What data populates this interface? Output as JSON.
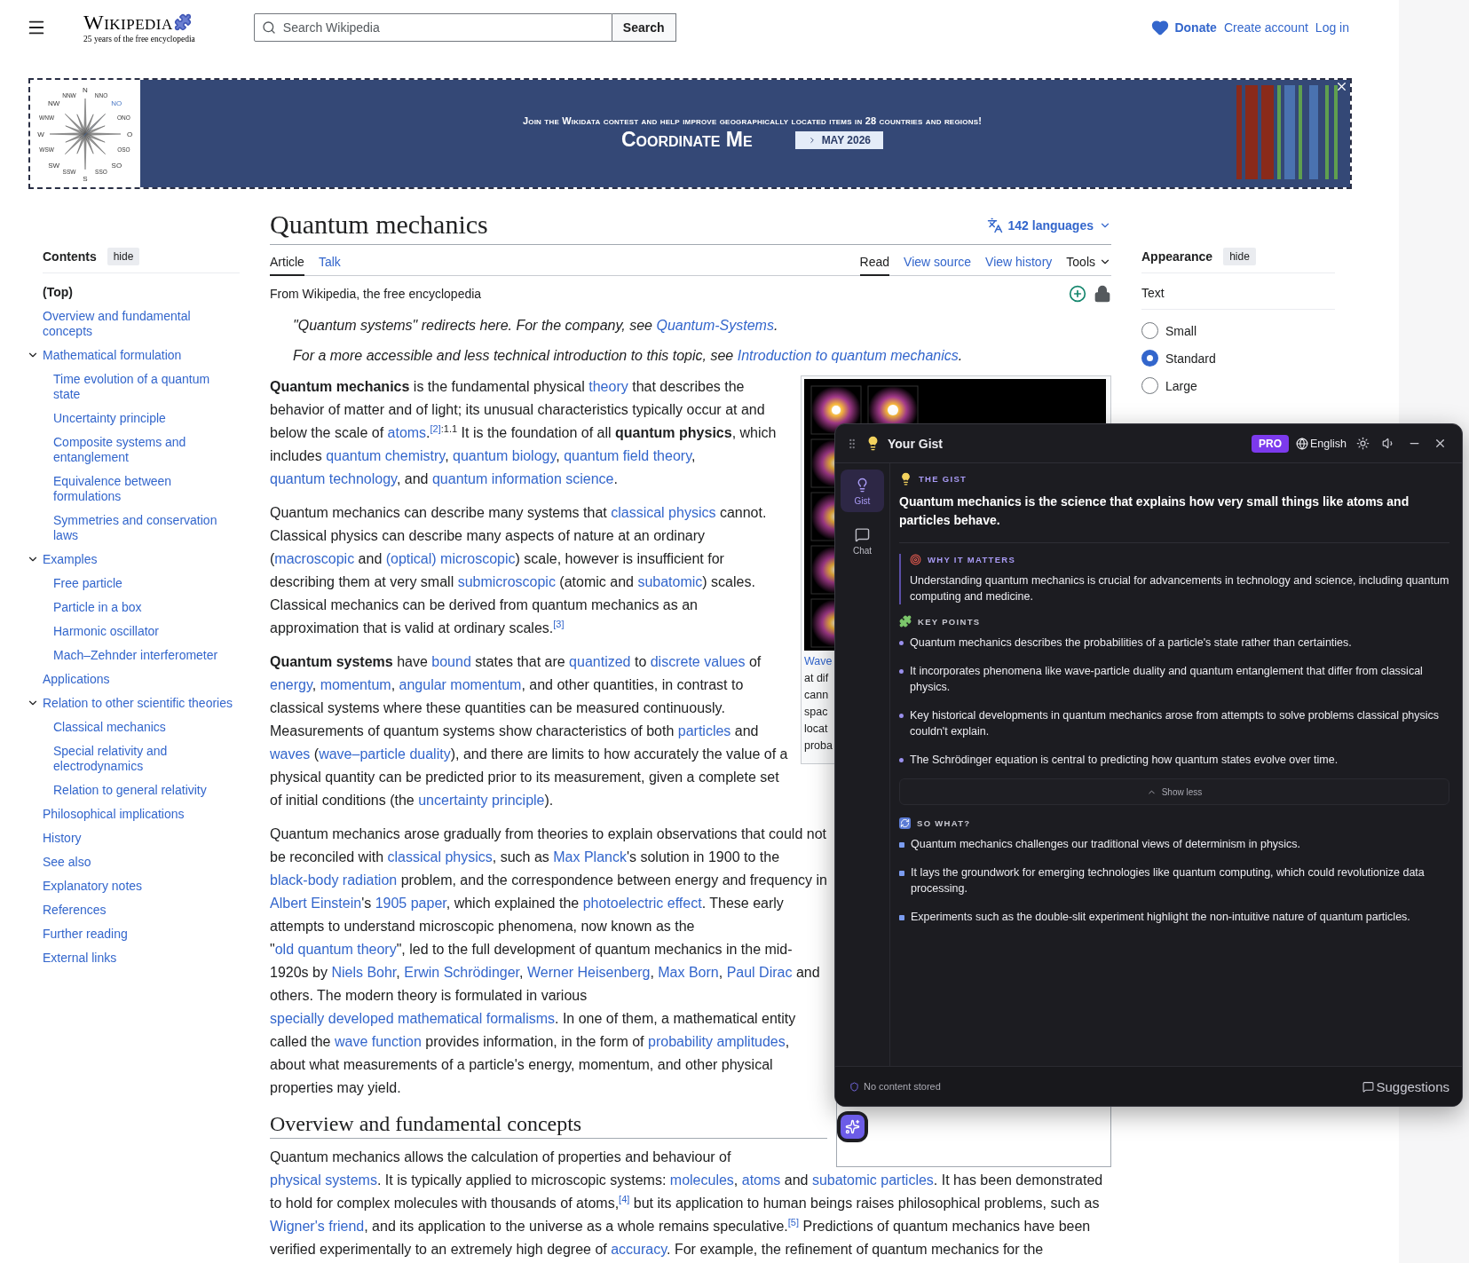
{
  "header": {
    "wordmark": "Wikipedia",
    "tagline": "25 years of the free encyclopedia",
    "search": {
      "placeholder": "Search Wikipedia",
      "button": "Search"
    },
    "links": [
      {
        "label": "Donate",
        "kind": "donate"
      },
      {
        "label": "Create account",
        "kind": "plain"
      },
      {
        "label": "Log in",
        "kind": "plain"
      }
    ]
  },
  "banner": {
    "compass_labels": [
      "N",
      "NNW",
      "NNO",
      "NW",
      "NO",
      "WNW",
      "ONO",
      "W",
      "O",
      "WSW",
      "OSO",
      "SW",
      "SO",
      "SSW",
      "SSO",
      "S"
    ],
    "headline": "Join the Wikidata contest and help improve geographically located items in 28 countries and regions!",
    "title": "Coordinate Me",
    "date": "MAY 2026"
  },
  "toc": {
    "title": "Contents",
    "hide": "hide",
    "items": [
      {
        "label": "(Top)",
        "selected": true
      },
      {
        "label": "Overview and fundamental concepts",
        "selected": false
      },
      {
        "label": "Mathematical formulation",
        "selected": false,
        "expanded": true,
        "children": [
          {
            "label": "Time evolution of a quantum state",
            "selected": false
          },
          {
            "label": "Uncertainty principle",
            "selected": false
          },
          {
            "label": "Composite systems and entanglement",
            "selected": false
          },
          {
            "label": "Equivalence between formulations",
            "selected": false
          },
          {
            "label": "Symmetries and conservation laws",
            "selected": false
          }
        ]
      },
      {
        "label": "Examples",
        "selected": false,
        "expanded": true,
        "children": [
          {
            "label": "Free particle",
            "selected": false
          },
          {
            "label": "Particle in a box",
            "selected": false
          },
          {
            "label": "Harmonic oscillator",
            "selected": false
          },
          {
            "label": "Mach–Zehnder interferometer",
            "selected": false
          }
        ]
      },
      {
        "label": "Applications",
        "selected": false
      },
      {
        "label": "Relation to other scientific theories",
        "selected": false,
        "expanded": true,
        "children": [
          {
            "label": "Classical mechanics",
            "selected": false
          },
          {
            "label": "Special relativity and electrodynamics",
            "selected": false
          },
          {
            "label": "Relation to general relativity",
            "selected": false
          }
        ]
      },
      {
        "label": "Philosophical implications",
        "selected": false
      },
      {
        "label": "History",
        "selected": false
      },
      {
        "label": "See also",
        "selected": false
      },
      {
        "label": "Explanatory notes",
        "selected": false
      },
      {
        "label": "References",
        "selected": false
      },
      {
        "label": "Further reading",
        "selected": false
      },
      {
        "label": "External links",
        "selected": false
      }
    ]
  },
  "article": {
    "title": "Quantum mechanics",
    "languages": "142 languages",
    "tabs_left": [
      {
        "label": "Article",
        "selected": true
      },
      {
        "label": "Talk",
        "selected": false
      }
    ],
    "tabs_right": [
      {
        "label": "Read",
        "selected": true
      },
      {
        "label": "View source",
        "selected": false
      },
      {
        "label": "View history",
        "selected": false
      }
    ],
    "tools": "Tools",
    "tagline": "From Wikipedia, the free encyclopedia",
    "infobox": {
      "caption_lines": [
        {
          "kind": "link",
          "text": "Wave"
        },
        {
          "kind": "text",
          "text": "at dif"
        },
        {
          "kind": "text",
          "text": "cann"
        },
        {
          "kind": "text",
          "text": "spac"
        },
        {
          "kind": "text",
          "text": "locat"
        },
        {
          "kind": "text",
          "text": "proba"
        }
      ]
    },
    "blocks": [
      {
        "kind": "hatnote",
        "runs": [
          {
            "kind": "text",
            "text": "\"Quantum systems\" redirects here. For the company, see "
          },
          {
            "kind": "link",
            "text": "Quantum-Systems"
          },
          {
            "kind": "text",
            "text": "."
          }
        ]
      },
      {
        "kind": "hatnote",
        "runs": [
          {
            "kind": "text",
            "text": "For a more accessible and less technical introduction to this topic, see "
          },
          {
            "kind": "link",
            "text": "Introduction to quantum mechanics"
          },
          {
            "kind": "text",
            "text": "."
          }
        ]
      },
      {
        "kind": "paragraph",
        "runs": [
          {
            "kind": "bold",
            "text": "Quantum mechanics"
          },
          {
            "kind": "text",
            "text": " is the fundamental physical "
          },
          {
            "kind": "link",
            "text": "theory"
          },
          {
            "kind": "text",
            "text": " that describes the behavior of matter and of light; its unusual characteristics typically occur at and below the scale of "
          },
          {
            "kind": "link",
            "text": "atoms"
          },
          {
            "kind": "text",
            "text": "."
          },
          {
            "kind": "ref",
            "text": "[2]"
          },
          {
            "kind": "sup",
            "text": ":1.1"
          },
          {
            "kind": "text",
            "text": " It is the foundation of all "
          },
          {
            "kind": "bold",
            "text": "quantum physics"
          },
          {
            "kind": "text",
            "text": ", which includes "
          },
          {
            "kind": "link",
            "text": "quantum chemistry"
          },
          {
            "kind": "text",
            "text": ", "
          },
          {
            "kind": "link",
            "text": "quantum biology"
          },
          {
            "kind": "text",
            "text": ", "
          },
          {
            "kind": "link",
            "text": "quantum field theory"
          },
          {
            "kind": "text",
            "text": ", "
          },
          {
            "kind": "link",
            "text": "quantum technology"
          },
          {
            "kind": "text",
            "text": ", and "
          },
          {
            "kind": "link",
            "text": "quantum information science"
          },
          {
            "kind": "text",
            "text": "."
          }
        ]
      },
      {
        "kind": "paragraph",
        "runs": [
          {
            "kind": "text",
            "text": "Quantum mechanics can describe many systems that "
          },
          {
            "kind": "link",
            "text": "classical physics"
          },
          {
            "kind": "text",
            "text": " cannot. Classical physics can describe many aspects of nature at an ordinary ("
          },
          {
            "kind": "link",
            "text": "macroscopic"
          },
          {
            "kind": "text",
            "text": " and "
          },
          {
            "kind": "link",
            "text": "(optical) microscopic"
          },
          {
            "kind": "text",
            "text": ") scale, however is insufficient for describing them at very small "
          },
          {
            "kind": "link",
            "text": "submicroscopic"
          },
          {
            "kind": "text",
            "text": " (atomic and "
          },
          {
            "kind": "link",
            "text": "subatomic"
          },
          {
            "kind": "text",
            "text": ") scales. Classical mechanics can be derived from quantum mechanics as an approximation that is valid at ordinary scales."
          },
          {
            "kind": "ref",
            "text": "[3]"
          }
        ]
      },
      {
        "kind": "paragraph",
        "runs": [
          {
            "kind": "bold",
            "text": "Quantum systems"
          },
          {
            "kind": "text",
            "text": " have "
          },
          {
            "kind": "link",
            "text": "bound"
          },
          {
            "kind": "text",
            "text": " states that are "
          },
          {
            "kind": "link",
            "text": "quantized"
          },
          {
            "kind": "text",
            "text": " to "
          },
          {
            "kind": "link",
            "text": "discrete values"
          },
          {
            "kind": "text",
            "text": " of "
          },
          {
            "kind": "link",
            "text": "energy"
          },
          {
            "kind": "text",
            "text": ", "
          },
          {
            "kind": "link",
            "text": "momentum"
          },
          {
            "kind": "text",
            "text": ", "
          },
          {
            "kind": "link",
            "text": "angular momentum"
          },
          {
            "kind": "text",
            "text": ", and other quantities, in contrast to classical systems where these quantities can be measured continuously. Measurements of quantum systems show characteristics of both "
          },
          {
            "kind": "link",
            "text": "particles"
          },
          {
            "kind": "text",
            "text": " and "
          },
          {
            "kind": "link",
            "text": "waves"
          },
          {
            "kind": "text",
            "text": " ("
          },
          {
            "kind": "link",
            "text": "wave–particle duality"
          },
          {
            "kind": "text",
            "text": "), and there are limits to how accurately the value of a physical quantity can be predicted prior to its measurement, given a complete set of initial conditions (the "
          },
          {
            "kind": "link",
            "text": "uncertainty principle"
          },
          {
            "kind": "text",
            "text": ")."
          }
        ]
      },
      {
        "kind": "paragraph",
        "runs": [
          {
            "kind": "text",
            "text": "Quantum mechanics arose gradually from theories to explain observations that could not be reconciled with "
          },
          {
            "kind": "link",
            "text": "classical physics"
          },
          {
            "kind": "text",
            "text": ", such as "
          },
          {
            "kind": "link",
            "text": "Max Planck"
          },
          {
            "kind": "text",
            "text": "'s solution in 1900 to the "
          },
          {
            "kind": "link",
            "text": "black-body radiation"
          },
          {
            "kind": "text",
            "text": " problem, and the correspondence between energy and frequency in "
          },
          {
            "kind": "link",
            "text": "Albert Einstein"
          },
          {
            "kind": "text",
            "text": "'s "
          },
          {
            "kind": "link",
            "text": "1905 paper"
          },
          {
            "kind": "text",
            "text": ", which explained the "
          },
          {
            "kind": "link",
            "text": "photoelectric effect"
          },
          {
            "kind": "text",
            "text": ". These early attempts to understand microscopic phenomena, now known as the \""
          },
          {
            "kind": "link",
            "text": "old quantum theory"
          },
          {
            "kind": "text",
            "text": "\", led to the full development of quantum mechanics in the mid-1920s by "
          },
          {
            "kind": "link",
            "text": "Niels Bohr"
          },
          {
            "kind": "text",
            "text": ", "
          },
          {
            "kind": "link",
            "text": "Erwin Schrödinger"
          },
          {
            "kind": "text",
            "text": ", "
          },
          {
            "kind": "link",
            "text": "Werner Heisenberg"
          },
          {
            "kind": "text",
            "text": ", "
          },
          {
            "kind": "link",
            "text": "Max Born"
          },
          {
            "kind": "text",
            "text": ", "
          },
          {
            "kind": "link",
            "text": "Paul Dirac"
          },
          {
            "kind": "text",
            "text": " and others. The modern theory is formulated in various "
          },
          {
            "kind": "link",
            "text": "specially developed mathematical formalisms"
          },
          {
            "kind": "text",
            "text": ". In one of them, a mathematical entity called the "
          },
          {
            "kind": "link",
            "text": "wave function"
          },
          {
            "kind": "text",
            "text": " provides information, in the form of "
          },
          {
            "kind": "link",
            "text": "probability amplitudes"
          },
          {
            "kind": "text",
            "text": ", about what measurements of a particle's energy, momentum, and other physical properties may yield."
          }
        ]
      },
      {
        "kind": "heading",
        "text": "Overview and fundamental concepts"
      },
      {
        "kind": "paragraph",
        "runs": [
          {
            "kind": "text",
            "text": "Quantum mechanics allows the calculation of properties and behaviour of "
          },
          {
            "kind": "link",
            "text": "physical systems"
          },
          {
            "kind": "text",
            "text": ". It is typically applied to microscopic systems: "
          },
          {
            "kind": "link",
            "text": "molecules"
          },
          {
            "kind": "text",
            "text": ", "
          },
          {
            "kind": "link",
            "text": "atoms"
          },
          {
            "kind": "text",
            "text": " and "
          },
          {
            "kind": "link",
            "text": "subatomic particles"
          },
          {
            "kind": "text",
            "text": ". It has been demonstrated to hold for complex molecules with thousands of atoms,"
          },
          {
            "kind": "ref",
            "text": "[4]"
          },
          {
            "kind": "text",
            "text": " but its application to human beings raises philosophical problems, such as "
          },
          {
            "kind": "link",
            "text": "Wigner's friend"
          },
          {
            "kind": "text",
            "text": ", and its application to the universe as a whole remains speculative."
          },
          {
            "kind": "ref",
            "text": "[5]"
          },
          {
            "kind": "text",
            "text": " Predictions of quantum mechanics have been verified experimentally to an extremely high degree of "
          },
          {
            "kind": "link",
            "text": "accuracy"
          },
          {
            "kind": "text",
            "text": ". For example, the refinement of quantum mechanics for the"
          }
        ]
      }
    ]
  },
  "appearance": {
    "title": "Appearance",
    "hide": "hide",
    "group": "Text",
    "options": [
      {
        "label": "Small",
        "selected": false
      },
      {
        "label": "Standard",
        "selected": true
      },
      {
        "label": "Large",
        "selected": false
      }
    ]
  },
  "gist": {
    "title": "Your Gist",
    "badge": "PRO",
    "language": "English",
    "rail": [
      {
        "label": "Gist",
        "kind": "gist",
        "selected": true
      },
      {
        "label": "Chat",
        "kind": "chat",
        "selected": false
      }
    ],
    "gist_label": "THE GIST",
    "gist": "Quantum mechanics is the science that explains how very small things like atoms and particles behave.",
    "why_label": "WHY IT MATTERS",
    "why": "Understanding quantum mechanics is crucial for advancements in technology and science, including quantum computing and medicine.",
    "key_label": "KEY POINTS",
    "key_points": [
      "Quantum mechanics describes the probabilities of a particle's state rather than certainties.",
      "It incorporates phenomena like wave-particle duality and quantum entanglement that differ from classical physics.",
      "Key historical developments in quantum mechanics arose from attempts to solve problems classical physics couldn't explain.",
      "The Schrödinger equation is central to predicting how quantum states evolve over time."
    ],
    "show_less": "Show less",
    "so_label": "SO WHAT?",
    "so_what": [
      "Quantum mechanics challenges our traditional views of determinism in physics.",
      "It lays the groundwork for emerging technologies like quantum computing, which could revolutionize data processing.",
      "Experiments such as the double-slit experiment highlight the non-intuitive nature of quantum particles."
    ],
    "footer": "No content stored",
    "suggestions": "Suggestions"
  }
}
